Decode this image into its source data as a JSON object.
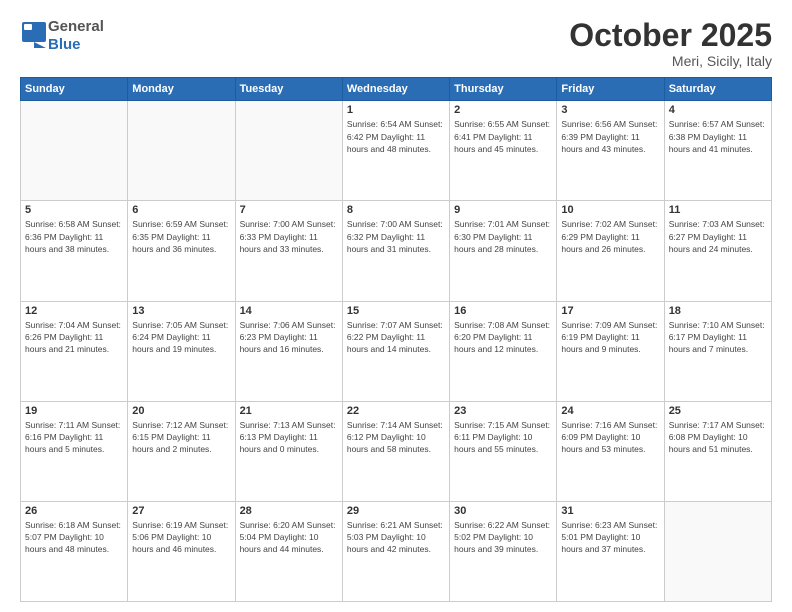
{
  "header": {
    "logo_general": "General",
    "logo_blue": "Blue",
    "month": "October 2025",
    "location": "Meri, Sicily, Italy"
  },
  "weekdays": [
    "Sunday",
    "Monday",
    "Tuesday",
    "Wednesday",
    "Thursday",
    "Friday",
    "Saturday"
  ],
  "rows": [
    [
      {
        "day": "",
        "info": ""
      },
      {
        "day": "",
        "info": ""
      },
      {
        "day": "",
        "info": ""
      },
      {
        "day": "1",
        "info": "Sunrise: 6:54 AM\nSunset: 6:42 PM\nDaylight: 11 hours\nand 48 minutes."
      },
      {
        "day": "2",
        "info": "Sunrise: 6:55 AM\nSunset: 6:41 PM\nDaylight: 11 hours\nand 45 minutes."
      },
      {
        "day": "3",
        "info": "Sunrise: 6:56 AM\nSunset: 6:39 PM\nDaylight: 11 hours\nand 43 minutes."
      },
      {
        "day": "4",
        "info": "Sunrise: 6:57 AM\nSunset: 6:38 PM\nDaylight: 11 hours\nand 41 minutes."
      }
    ],
    [
      {
        "day": "5",
        "info": "Sunrise: 6:58 AM\nSunset: 6:36 PM\nDaylight: 11 hours\nand 38 minutes."
      },
      {
        "day": "6",
        "info": "Sunrise: 6:59 AM\nSunset: 6:35 PM\nDaylight: 11 hours\nand 36 minutes."
      },
      {
        "day": "7",
        "info": "Sunrise: 7:00 AM\nSunset: 6:33 PM\nDaylight: 11 hours\nand 33 minutes."
      },
      {
        "day": "8",
        "info": "Sunrise: 7:00 AM\nSunset: 6:32 PM\nDaylight: 11 hours\nand 31 minutes."
      },
      {
        "day": "9",
        "info": "Sunrise: 7:01 AM\nSunset: 6:30 PM\nDaylight: 11 hours\nand 28 minutes."
      },
      {
        "day": "10",
        "info": "Sunrise: 7:02 AM\nSunset: 6:29 PM\nDaylight: 11 hours\nand 26 minutes."
      },
      {
        "day": "11",
        "info": "Sunrise: 7:03 AM\nSunset: 6:27 PM\nDaylight: 11 hours\nand 24 minutes."
      }
    ],
    [
      {
        "day": "12",
        "info": "Sunrise: 7:04 AM\nSunset: 6:26 PM\nDaylight: 11 hours\nand 21 minutes."
      },
      {
        "day": "13",
        "info": "Sunrise: 7:05 AM\nSunset: 6:24 PM\nDaylight: 11 hours\nand 19 minutes."
      },
      {
        "day": "14",
        "info": "Sunrise: 7:06 AM\nSunset: 6:23 PM\nDaylight: 11 hours\nand 16 minutes."
      },
      {
        "day": "15",
        "info": "Sunrise: 7:07 AM\nSunset: 6:22 PM\nDaylight: 11 hours\nand 14 minutes."
      },
      {
        "day": "16",
        "info": "Sunrise: 7:08 AM\nSunset: 6:20 PM\nDaylight: 11 hours\nand 12 minutes."
      },
      {
        "day": "17",
        "info": "Sunrise: 7:09 AM\nSunset: 6:19 PM\nDaylight: 11 hours\nand 9 minutes."
      },
      {
        "day": "18",
        "info": "Sunrise: 7:10 AM\nSunset: 6:17 PM\nDaylight: 11 hours\nand 7 minutes."
      }
    ],
    [
      {
        "day": "19",
        "info": "Sunrise: 7:11 AM\nSunset: 6:16 PM\nDaylight: 11 hours\nand 5 minutes."
      },
      {
        "day": "20",
        "info": "Sunrise: 7:12 AM\nSunset: 6:15 PM\nDaylight: 11 hours\nand 2 minutes."
      },
      {
        "day": "21",
        "info": "Sunrise: 7:13 AM\nSunset: 6:13 PM\nDaylight: 11 hours\nand 0 minutes."
      },
      {
        "day": "22",
        "info": "Sunrise: 7:14 AM\nSunset: 6:12 PM\nDaylight: 10 hours\nand 58 minutes."
      },
      {
        "day": "23",
        "info": "Sunrise: 7:15 AM\nSunset: 6:11 PM\nDaylight: 10 hours\nand 55 minutes."
      },
      {
        "day": "24",
        "info": "Sunrise: 7:16 AM\nSunset: 6:09 PM\nDaylight: 10 hours\nand 53 minutes."
      },
      {
        "day": "25",
        "info": "Sunrise: 7:17 AM\nSunset: 6:08 PM\nDaylight: 10 hours\nand 51 minutes."
      }
    ],
    [
      {
        "day": "26",
        "info": "Sunrise: 6:18 AM\nSunset: 5:07 PM\nDaylight: 10 hours\nand 48 minutes."
      },
      {
        "day": "27",
        "info": "Sunrise: 6:19 AM\nSunset: 5:06 PM\nDaylight: 10 hours\nand 46 minutes."
      },
      {
        "day": "28",
        "info": "Sunrise: 6:20 AM\nSunset: 5:04 PM\nDaylight: 10 hours\nand 44 minutes."
      },
      {
        "day": "29",
        "info": "Sunrise: 6:21 AM\nSunset: 5:03 PM\nDaylight: 10 hours\nand 42 minutes."
      },
      {
        "day": "30",
        "info": "Sunrise: 6:22 AM\nSunset: 5:02 PM\nDaylight: 10 hours\nand 39 minutes."
      },
      {
        "day": "31",
        "info": "Sunrise: 6:23 AM\nSunset: 5:01 PM\nDaylight: 10 hours\nand 37 minutes."
      },
      {
        "day": "",
        "info": ""
      }
    ]
  ]
}
